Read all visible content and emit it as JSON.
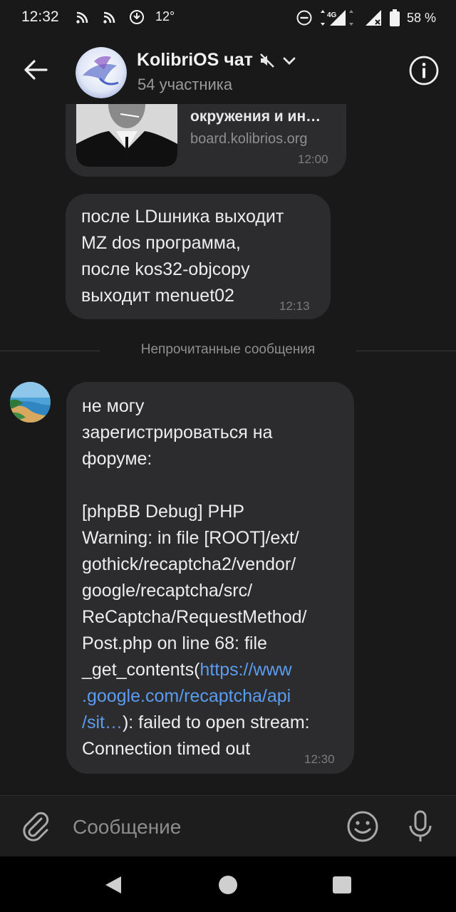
{
  "status_bar": {
    "time": "12:32",
    "temperature": "12°",
    "network": "4G",
    "battery": "58 %"
  },
  "header": {
    "title": "KolibriOS чат",
    "subtitle": "54 участника",
    "icons": [
      "back-arrow-icon",
      "muted-icon",
      "chevron-down-icon",
      "info-icon"
    ]
  },
  "messages": [
    {
      "type": "link_preview",
      "title": "окружения и ин…",
      "domain": "board.kolibrios.org",
      "time": "12:00"
    },
    {
      "type": "text",
      "text": "после LDшника выходит\nMZ dos программа,\nпосле kos32-objcopy\nвыходит menuet02",
      "time": "12:13"
    },
    {
      "type": "text",
      "text_before": "не могу\nзарегистрироваться на\nфоруме:\n\n[phpBB Debug] PHP\nWarning: in file [ROOT]/ext/\ngothick/recaptcha2/vendor/\ngoogle/recaptcha/src/\nReCaptcha/RequestMethod/\nPost.php on line 68: file\n_get_contents(",
      "link": "https://www\n.google.com/recaptcha/api\n/sit…",
      "text_after": "): failed to open stream:\nConnection timed out",
      "time": "12:30"
    }
  ],
  "unread_divider": "Непрочитанные сообщения",
  "composer": {
    "placeholder": "Сообщение",
    "icons": [
      "attach-icon",
      "emoji-icon",
      "mic-icon"
    ]
  },
  "colors": {
    "background": "#191919",
    "bubble": "#2c2c2e",
    "link": "#5a9cf0"
  }
}
